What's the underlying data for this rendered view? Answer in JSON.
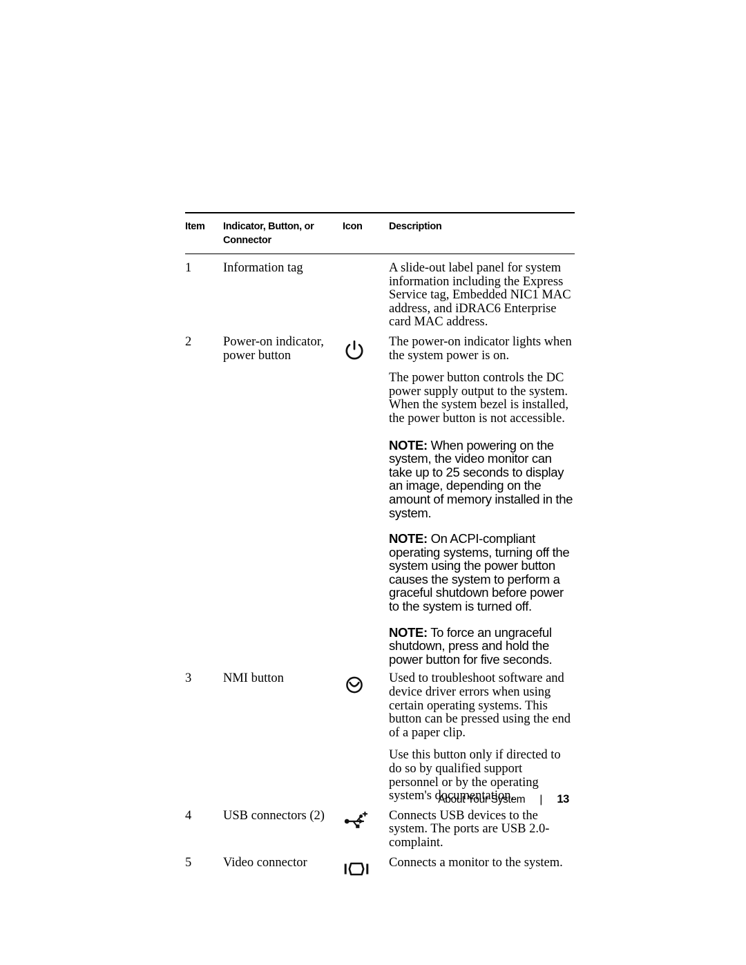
{
  "document": {
    "footer": {
      "section_label": "About Your System",
      "separator": "|",
      "page_number": "13"
    }
  },
  "table": {
    "headers": {
      "item": "Item",
      "connector_line1": "Indicator, Button, or",
      "connector_line2": "Connector",
      "icon": "Icon",
      "description": "Description"
    },
    "rows": [
      {
        "item": "1",
        "label_line1": "Information tag",
        "label_line2": "",
        "icon": "none",
        "paragraphs": [
          "A slide-out label panel for system information including the Express Service tag, Embedded NIC1 MAC address, and iDRAC6 Enterprise card MAC address."
        ],
        "notes": []
      },
      {
        "item": "2",
        "label_line1": "Power-on indicator,",
        "label_line2": "power button",
        "icon": "power-icon",
        "paragraphs": [
          "The power-on indicator lights when the system power is on.",
          "The power button controls the DC power supply output to the system. When the system bezel is installed, the power button is not accessible."
        ],
        "notes": [
          {
            "label": "NOTE:",
            "text": " When powering on the system, the video monitor can take up to 25 seconds to display an image, depending on the amount of memory installed in the system."
          },
          {
            "label": "NOTE:",
            "text": " On ACPI-compliant operating systems, turning off the system using the power button causes the system to perform a graceful shutdown before power to the system is turned off."
          },
          {
            "label": "NOTE:",
            "text": " To force an ungraceful shutdown, press and hold the power button for five seconds."
          }
        ]
      },
      {
        "item": "3",
        "label_line1": "NMI button",
        "label_line2": "",
        "icon": "nmi-icon",
        "paragraphs": [
          "Used to troubleshoot software and device driver errors when using certain operating systems. This button can be pressed using the end of a paper clip.",
          "Use this button only if directed to do so by qualified support personnel or by the operating system's documentation."
        ],
        "notes": []
      },
      {
        "item": "4",
        "label_line1": "USB connectors (2)",
        "label_line2": "",
        "icon": "usb-icon",
        "paragraphs": [
          "Connects USB devices to the system. The ports are USB 2.0-complaint."
        ],
        "notes": []
      },
      {
        "item": "5",
        "label_line1": "Video connector",
        "label_line2": "",
        "icon": "video-icon",
        "paragraphs": [
          "Connects a monitor to the system."
        ],
        "notes": []
      }
    ]
  },
  "colors": {
    "text": "#000000",
    "background": "#ffffff",
    "rule": "#000000"
  }
}
